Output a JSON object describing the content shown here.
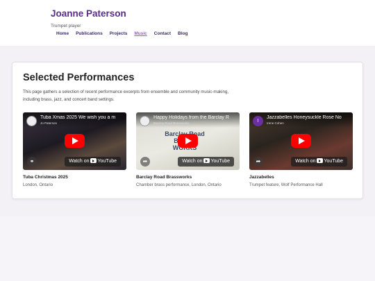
{
  "site": {
    "title": "Joanne Paterson",
    "tagline": "Trumpet player"
  },
  "nav": {
    "items": [
      {
        "label": "Home",
        "active": false
      },
      {
        "label": "Publications",
        "active": false
      },
      {
        "label": "Projects",
        "active": false
      },
      {
        "label": "Music",
        "active": true
      },
      {
        "label": "Contact",
        "active": false
      },
      {
        "label": "Blog",
        "active": false
      }
    ]
  },
  "section": {
    "title": "Selected Performances",
    "description": "This page gathers a selection of recent performance excerpts from ensemble and community music-making, including brass, jazz, and concert band settings."
  },
  "videos": [
    {
      "video_title": "Tuba Xmas 2025 We wish you a m",
      "channel": "Jo Paterson",
      "watch_label": "Watch on",
      "platform": "YouTube",
      "caption_title": "Tuba Christmas 2025",
      "caption_sub": "London, Ontario",
      "corner_icon": "link-icon"
    },
    {
      "video_title": "Happy Holidays from the Barclay R",
      "channel": "Barclay Road Brassworks",
      "watch_label": "Watch on",
      "platform": "YouTube",
      "caption_title": "Barclay Road Brassworks",
      "caption_sub": "Chamber brass performance, London, Ontario",
      "corner_icon": "share-icon",
      "poster_text": "Barclay Road BRASS WORKS"
    },
    {
      "video_title": "Jazzabelles Honeysuckle Rose No",
      "channel": "Irene Cohen",
      "avatar_letter": "I",
      "watch_label": "Watch on",
      "platform": "YouTube",
      "caption_title": "Jazzabelles",
      "caption_sub": "Trumpet feature, Wolf Performance Hall",
      "corner_icon": "share-icon"
    }
  ],
  "colors": {
    "brand": "#5a2d8a",
    "nav_active": "#9a55d0",
    "youtube_red": "#ff0000"
  }
}
